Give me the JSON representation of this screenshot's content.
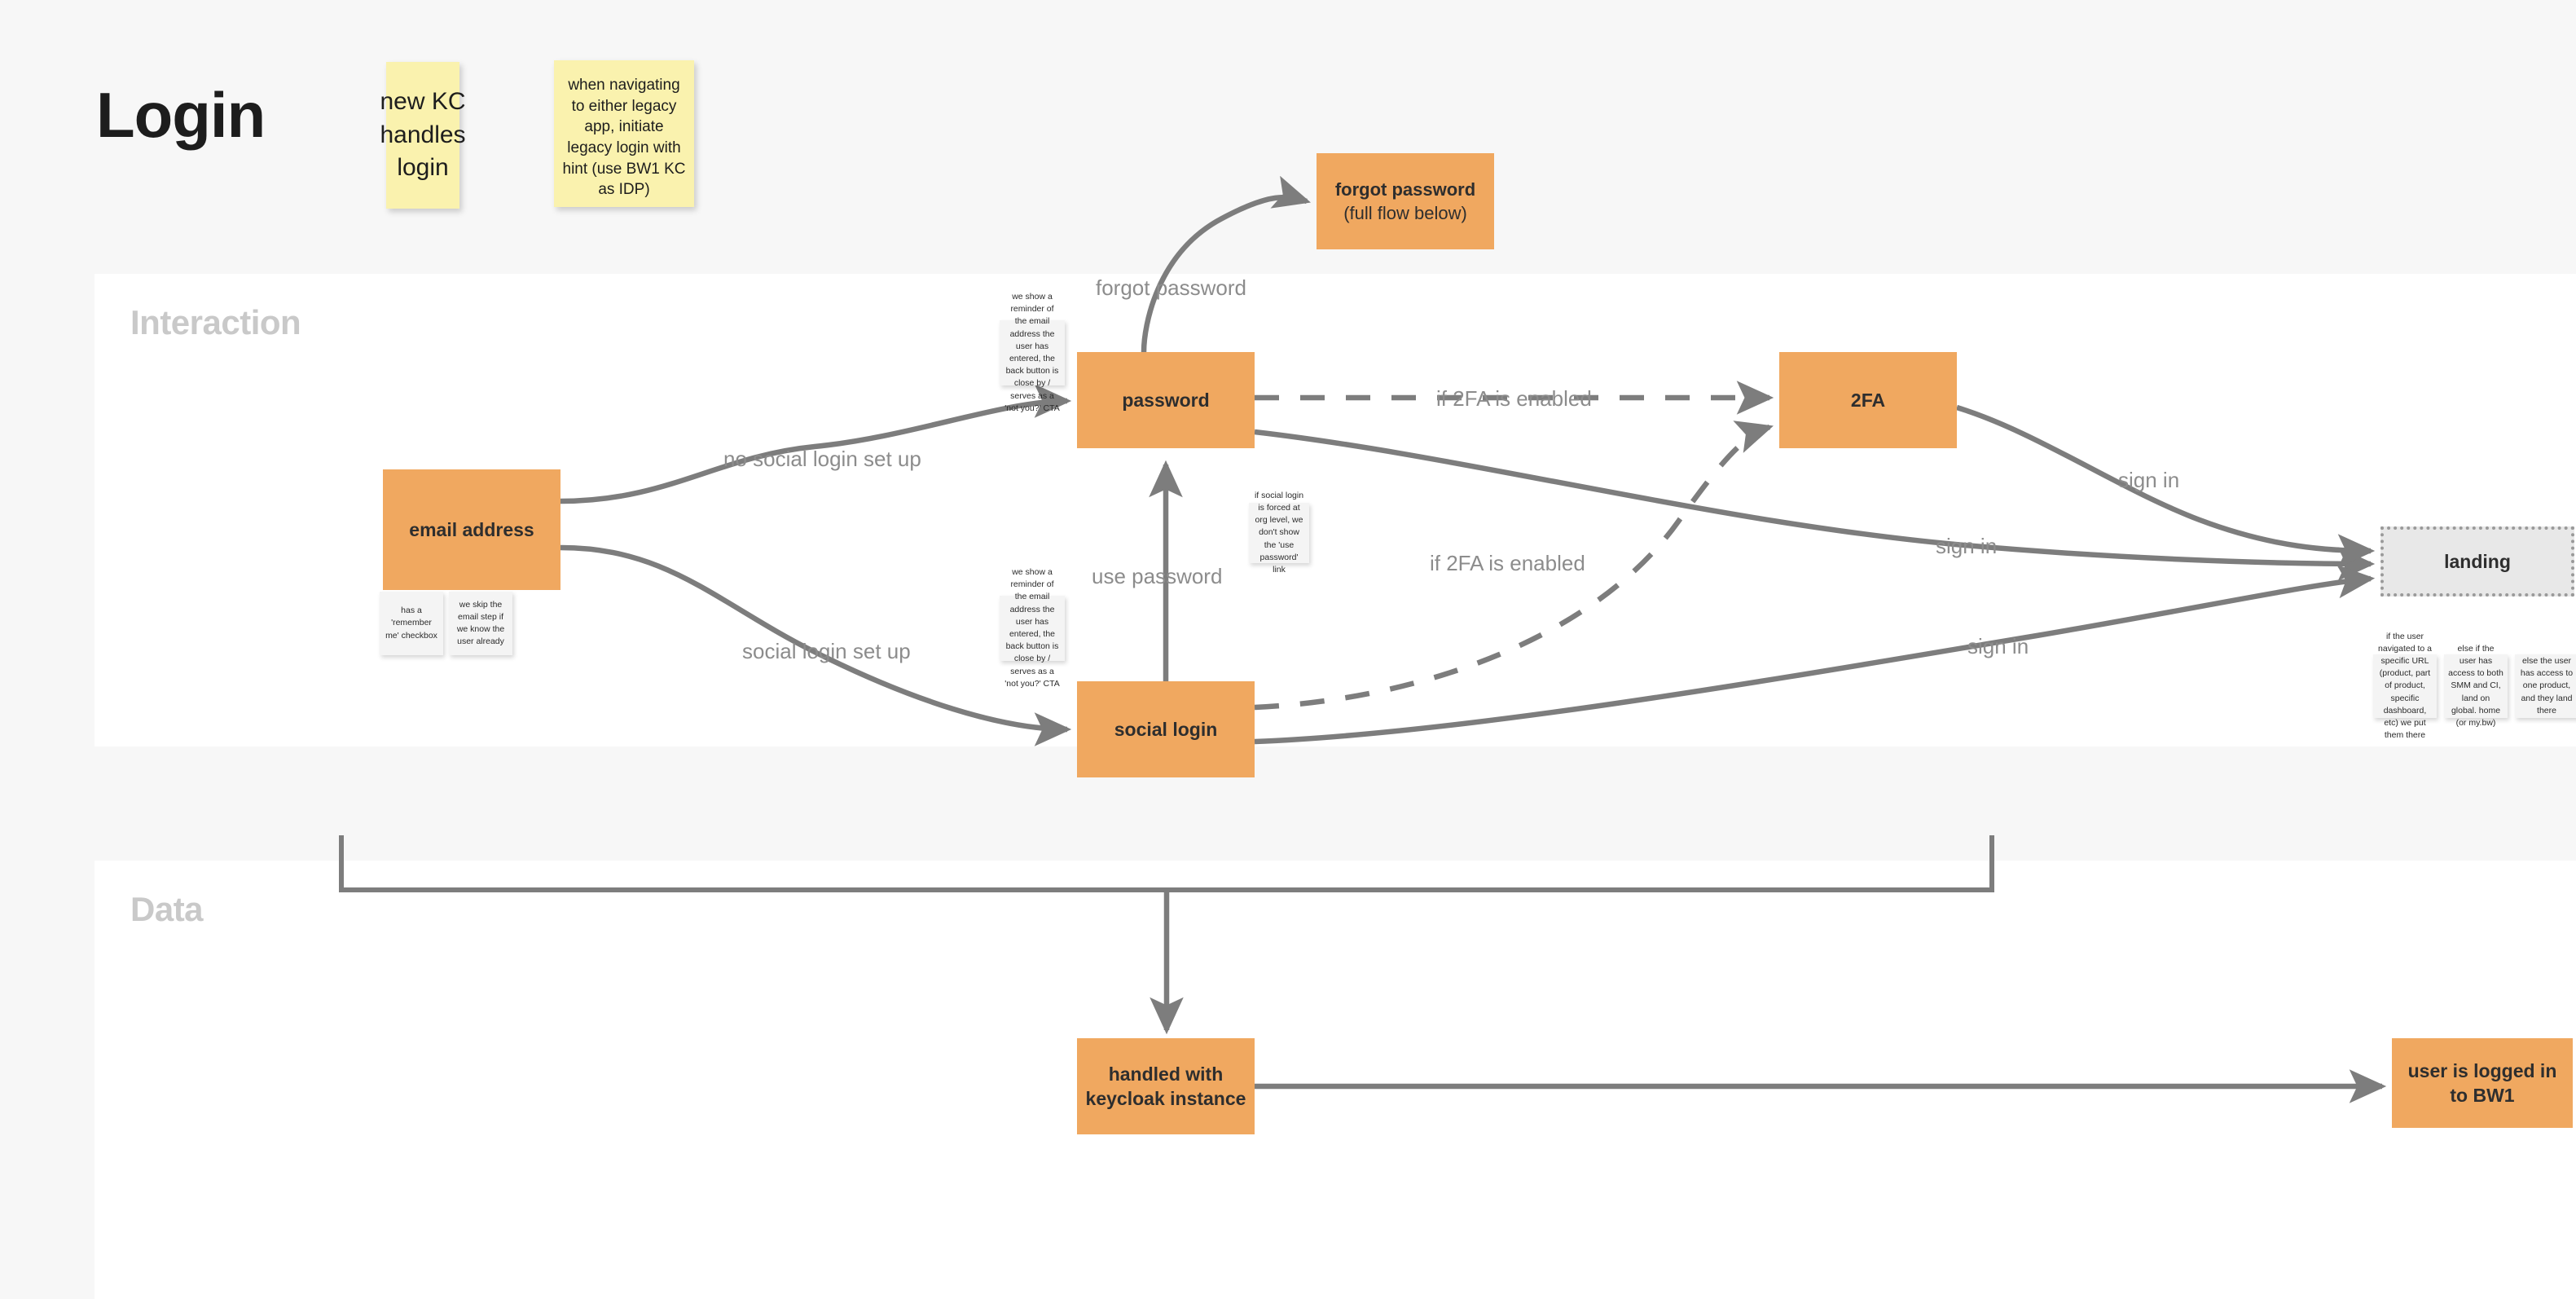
{
  "page": {
    "title": "Login"
  },
  "lanes": [
    {
      "id": "interaction",
      "title": "Interaction"
    },
    {
      "id": "data",
      "title": "Data"
    }
  ],
  "sticky_notes": [
    {
      "id": "kc",
      "text": "new KC handles login"
    },
    {
      "id": "legacy",
      "text": "when navigating to either legacy app, initiate legacy login with hint (use BW1 KC as IDP)"
    }
  ],
  "notes": [
    {
      "id": "remember",
      "text": "has a 'remember me' checkbox"
    },
    {
      "id": "skip_email",
      "text": "we skip the email step if we know the user already"
    },
    {
      "id": "reminder_1",
      "text": "we show a reminder of the email address the user has entered, the back button is close by / serves as a 'not you?' CTA"
    },
    {
      "id": "reminder_2",
      "text": "we show a reminder of the email address the user has entered, the back button is close by / serves as a 'not you?' CTA"
    },
    {
      "id": "forced_org",
      "text": "if social login is forced at org level, we don't show the 'use password' link"
    },
    {
      "id": "land_url",
      "text": "if the user navigated to a specific URL (product, part of product, specific dashboard, etc) we put them there"
    },
    {
      "id": "land_both",
      "text": "else if the user has access to both SMM and CI, land on global. home (or my.bw)"
    },
    {
      "id": "land_one",
      "text": "else the user has access to one product, and they land there"
    }
  ],
  "boxes": {
    "email": "email address",
    "password": "password",
    "social": "social login",
    "twofa": "2FA",
    "forgot_title": "forgot password",
    "forgot_sub": "(full flow below)",
    "landing": "landing",
    "keycloak": "handled with keycloak instance",
    "bw1": "user is logged in to BW1"
  },
  "edge_labels": {
    "no_social": "no social login set up",
    "social_set": "social login set up",
    "forgot": "forgot password",
    "use_password": "use password",
    "twofa_top": "if 2FA is enabled",
    "twofa_low": "if 2FA is enabled",
    "signin_1": "sign in",
    "signin_2": "sign in",
    "signin_3": "sign in"
  },
  "colors": {
    "box_orange": "#f0a860",
    "sticky_yellow": "#faf2ae",
    "note_grey": "#f4f4f4",
    "connector": "#7d7d7d",
    "lane_title": "#c9c9c9",
    "edge_label": "#8c8c8c",
    "canvas": "#f7f7f7",
    "lane_bg": "#ffffff",
    "landing_bg": "#e8e8e8"
  }
}
